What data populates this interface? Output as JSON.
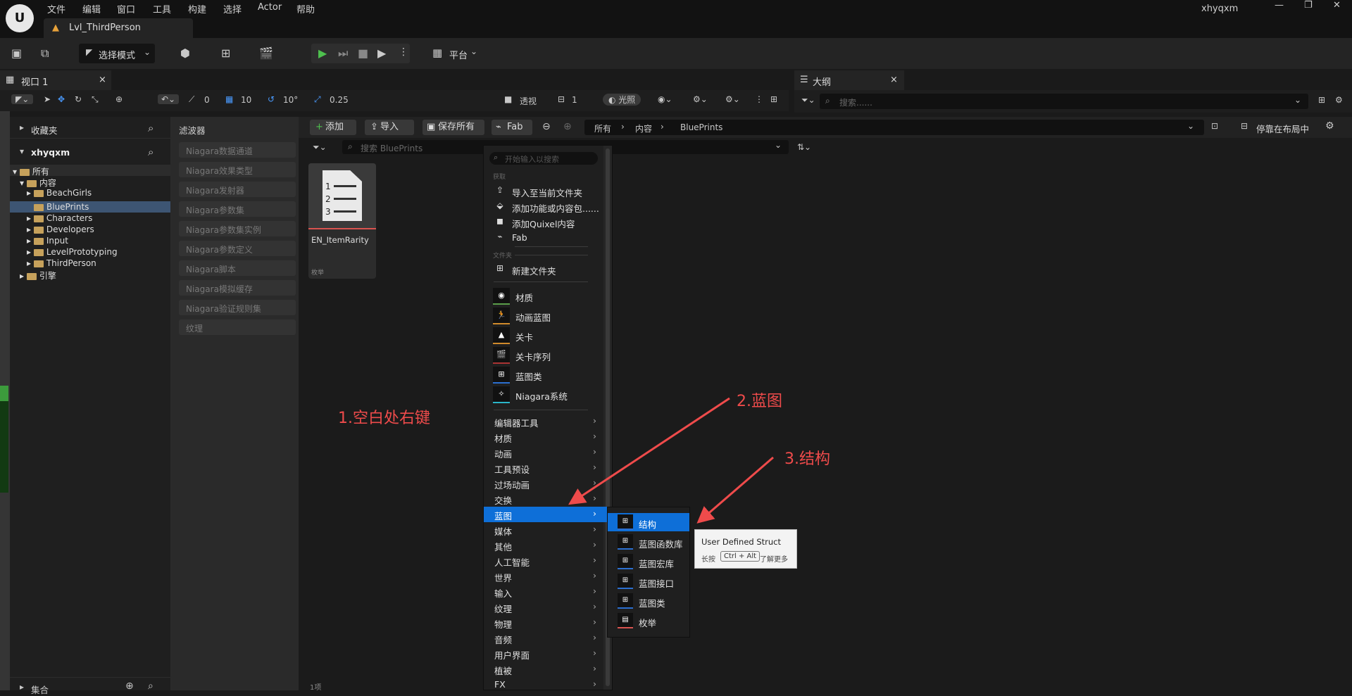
{
  "menubar": {
    "items": [
      "文件",
      "编辑",
      "窗口",
      "工具",
      "构建",
      "选择",
      "Actor",
      "帮助"
    ],
    "user": "xhyqxm"
  },
  "doc_tab": {
    "title": "Lvl_ThirdPerson"
  },
  "toolbar": {
    "mode_label": "选择模式",
    "platform_label": "平台"
  },
  "viewport": {
    "tab_label": "视口 1",
    "snap_angle": "0",
    "grid": "10",
    "rotation": "10°",
    "scale": "0.25",
    "perspective": "透视",
    "camera_speed": "1",
    "lighting": "光照"
  },
  "outliner": {
    "tab_label": "大纲",
    "search_placeholder": "搜索......"
  },
  "left_panel": {
    "favorites": "收藏夹",
    "project": "xhyqxm",
    "tree": [
      {
        "label": "所有",
        "level": 0
      },
      {
        "label": "内容",
        "level": 1
      },
      {
        "label": "BeachGirls",
        "level": 2
      },
      {
        "label": "BluePrints",
        "level": 2,
        "selected": true
      },
      {
        "label": "Characters",
        "level": 2
      },
      {
        "label": "Developers",
        "level": 2
      },
      {
        "label": "Input",
        "level": 2
      },
      {
        "label": "LevelPrototyping",
        "level": 2
      },
      {
        "label": "ThirdPerson",
        "level": 2
      },
      {
        "label": "引擎",
        "level": 0
      }
    ],
    "collections": "集合"
  },
  "filters": {
    "title": "滤波器",
    "items": [
      "Niagara数据通道",
      "Niagara效果类型",
      "Niagara发射器",
      "Niagara参数集",
      "Niagara参数集实例",
      "Niagara参数定义",
      "Niagara脚本",
      "Niagara模拟缓存",
      "Niagara验证规则集",
      "纹理"
    ]
  },
  "content_browser": {
    "add": "添加",
    "import": "导入",
    "save_all": "保存所有",
    "fab": "Fab",
    "path": [
      "所有",
      "内容",
      "BluePrints"
    ],
    "dock_label": "停靠在布局中",
    "search_placeholder": "搜索 BluePrints",
    "asset": {
      "name": "EN_ItemRarity",
      "type": "枚举",
      "lines": [
        "1",
        "2",
        "3"
      ]
    },
    "item_count": "1项"
  },
  "context_menu": {
    "search_placeholder": "开始输入以搜索",
    "section_get": "获取",
    "get_items": [
      "导入至当前文件夹",
      "添加功能或内容包......",
      "添加Quixel内容",
      "Fab"
    ],
    "section_folder": "文件夹",
    "new_folder": "新建文件夹",
    "assets": [
      "材质",
      "动画蓝图",
      "关卡",
      "关卡序列",
      "蓝图类",
      "Niagara系统"
    ],
    "categories": [
      "编辑器工具",
      "材质",
      "动画",
      "工具预设",
      "过场动画",
      "交换",
      "蓝图",
      "媒体",
      "其他",
      "人工智能",
      "世界",
      "输入",
      "纹理",
      "物理",
      "音频",
      "用户界面",
      "植被",
      "FX"
    ],
    "highlighted": "蓝图"
  },
  "submenu": {
    "items": [
      "结构",
      "蓝图函数库",
      "蓝图宏库",
      "蓝图接口",
      "蓝图类",
      "枚举"
    ],
    "highlighted": "结构"
  },
  "tooltip": {
    "title": "User Defined Struct",
    "hold": "长按",
    "keys": "Ctrl + Alt",
    "more": "了解更多"
  },
  "annotations": {
    "step1": "1.空白处右键",
    "step2": "2.蓝图",
    "step3": "3.结构",
    "color": "#ef4b4b"
  }
}
